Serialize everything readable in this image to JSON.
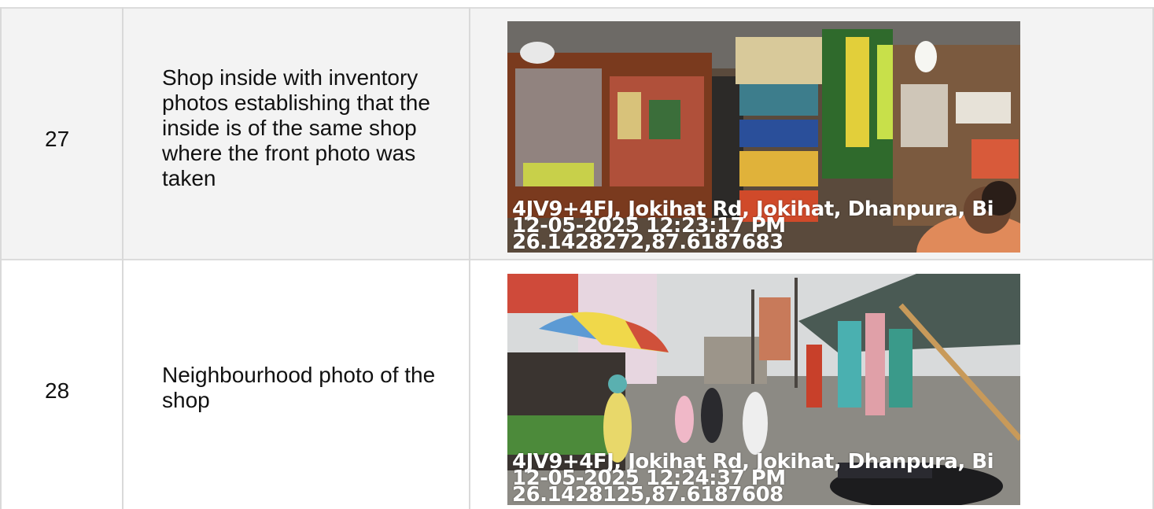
{
  "rows": [
    {
      "number": "27",
      "description": "Shop inside with inventory photos establishing that the inside is of the same shop where the front photo was taken",
      "photo": {
        "subject": "shop-interior-inventory",
        "stamp_address": "4JV9+4FJ, Jokihat Rd, Jokihat, Dhanpura, Bi",
        "stamp_datetime": "12-05-2025 12:23:17 PM",
        "stamp_coords": "26.1428272,87.6187683"
      }
    },
    {
      "number": "28",
      "description": "Neighbourhood photo of the shop",
      "photo": {
        "subject": "market-street-neighbourhood",
        "stamp_address": "4JV9+4FJ, Jokihat Rd, Jokihat, Dhanpura, Bi",
        "stamp_datetime": "12-05-2025 12:24:37 PM",
        "stamp_coords": "26.1428125,87.6187608"
      }
    }
  ],
  "colors": {
    "row_alt_bg": "#f3f3f3",
    "grid_line": "#d9d9d9",
    "text": "#111111",
    "stamp_text": "#ffffff"
  }
}
